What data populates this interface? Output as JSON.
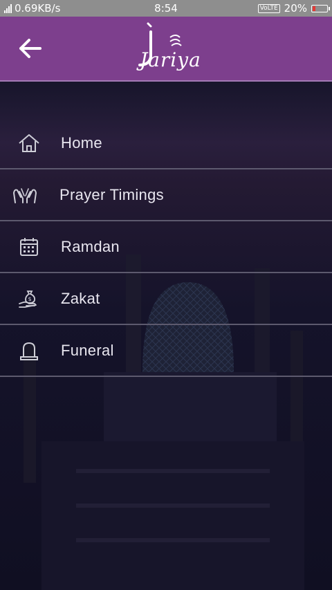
{
  "status_bar": {
    "network_speed": "0.69KB/s",
    "time": "8:54",
    "volte": "VoLTE",
    "battery_percent": "20%",
    "battery_level": 0.2
  },
  "header": {
    "back_icon": "arrow-left-icon",
    "logo_text": "Jariya",
    "background_color": "#7d3f8d"
  },
  "menu": {
    "items": [
      {
        "label": "Home",
        "icon": "home-icon"
      },
      {
        "label": "Prayer Timings",
        "icon": "praying-hands-icon"
      },
      {
        "label": "Ramdan",
        "icon": "calendar-icon"
      },
      {
        "label": "Zakat",
        "icon": "money-bag-hand-icon"
      },
      {
        "label": "Funeral",
        "icon": "tombstone-icon"
      }
    ]
  }
}
